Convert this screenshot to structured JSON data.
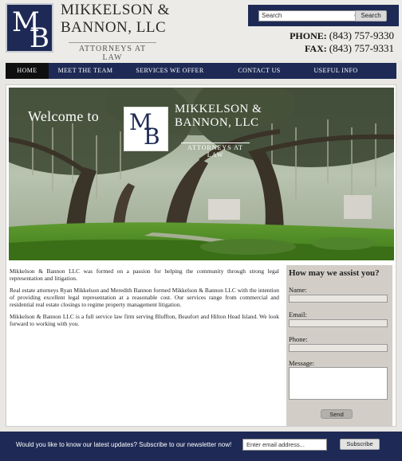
{
  "header": {
    "logo_letter_m": "M",
    "logo_letter_b": "B",
    "firm_line1": "MIKKELSON &",
    "firm_line2": "BANNON, LLC",
    "tagline": "ATTORNEYS AT LAW",
    "search_placeholder": "Search",
    "search_button": "Search",
    "phone_label": "PHONE:",
    "phone_number": "(843) 757-9330",
    "fax_label": "FAX:",
    "fax_number": "(843) 757-9331"
  },
  "nav": {
    "items": [
      {
        "label": "HOME"
      },
      {
        "label": "MEET THE TEAM"
      },
      {
        "label": "SERVICES WE OFFER"
      },
      {
        "label": "CONTACT US"
      },
      {
        "label": "USEFUL INFO"
      }
    ]
  },
  "hero": {
    "welcome": "Welcome to",
    "logo_letter_m": "M",
    "logo_letter_b": "B",
    "firm_line1": "MIKKELSON &",
    "firm_line2": "BANNON, LLC",
    "tagline": "ATTORNEYS AT LAW"
  },
  "body": {
    "p1": "Mikkelson & Bannon LLC was formed on a passion for helping the community through strong legal representation and litigation.",
    "p2": "Real estate attorneys Ryan Mikkelson and Meredith Bannon formed Mikkelson & Bannon LLC with the intention of providing excellent legal representation at a reasonable cost. Our services range from commercial and residential real estate closings to regime property management litigation.",
    "p3": "Mikkelson & Bannon LLC is a full service law firm serving Bluffton, Beaufort and Hilton Head Island. We look forward to working with you."
  },
  "form": {
    "title": "How may we assist you?",
    "name_label": "Name:",
    "email_label": "Email:",
    "phone_label": "Phone:",
    "message_label": "Message:",
    "send_button": "Send"
  },
  "footer": {
    "text": "Would you like to know our latest updates? Subscribe to our newsletter now!",
    "email_placeholder": "Enter email address...",
    "subscribe_button": "Subscribe"
  },
  "colors": {
    "navy": "#1e2a55",
    "active_nav": "#0f0f0f",
    "form_bg": "#d2cec7"
  }
}
